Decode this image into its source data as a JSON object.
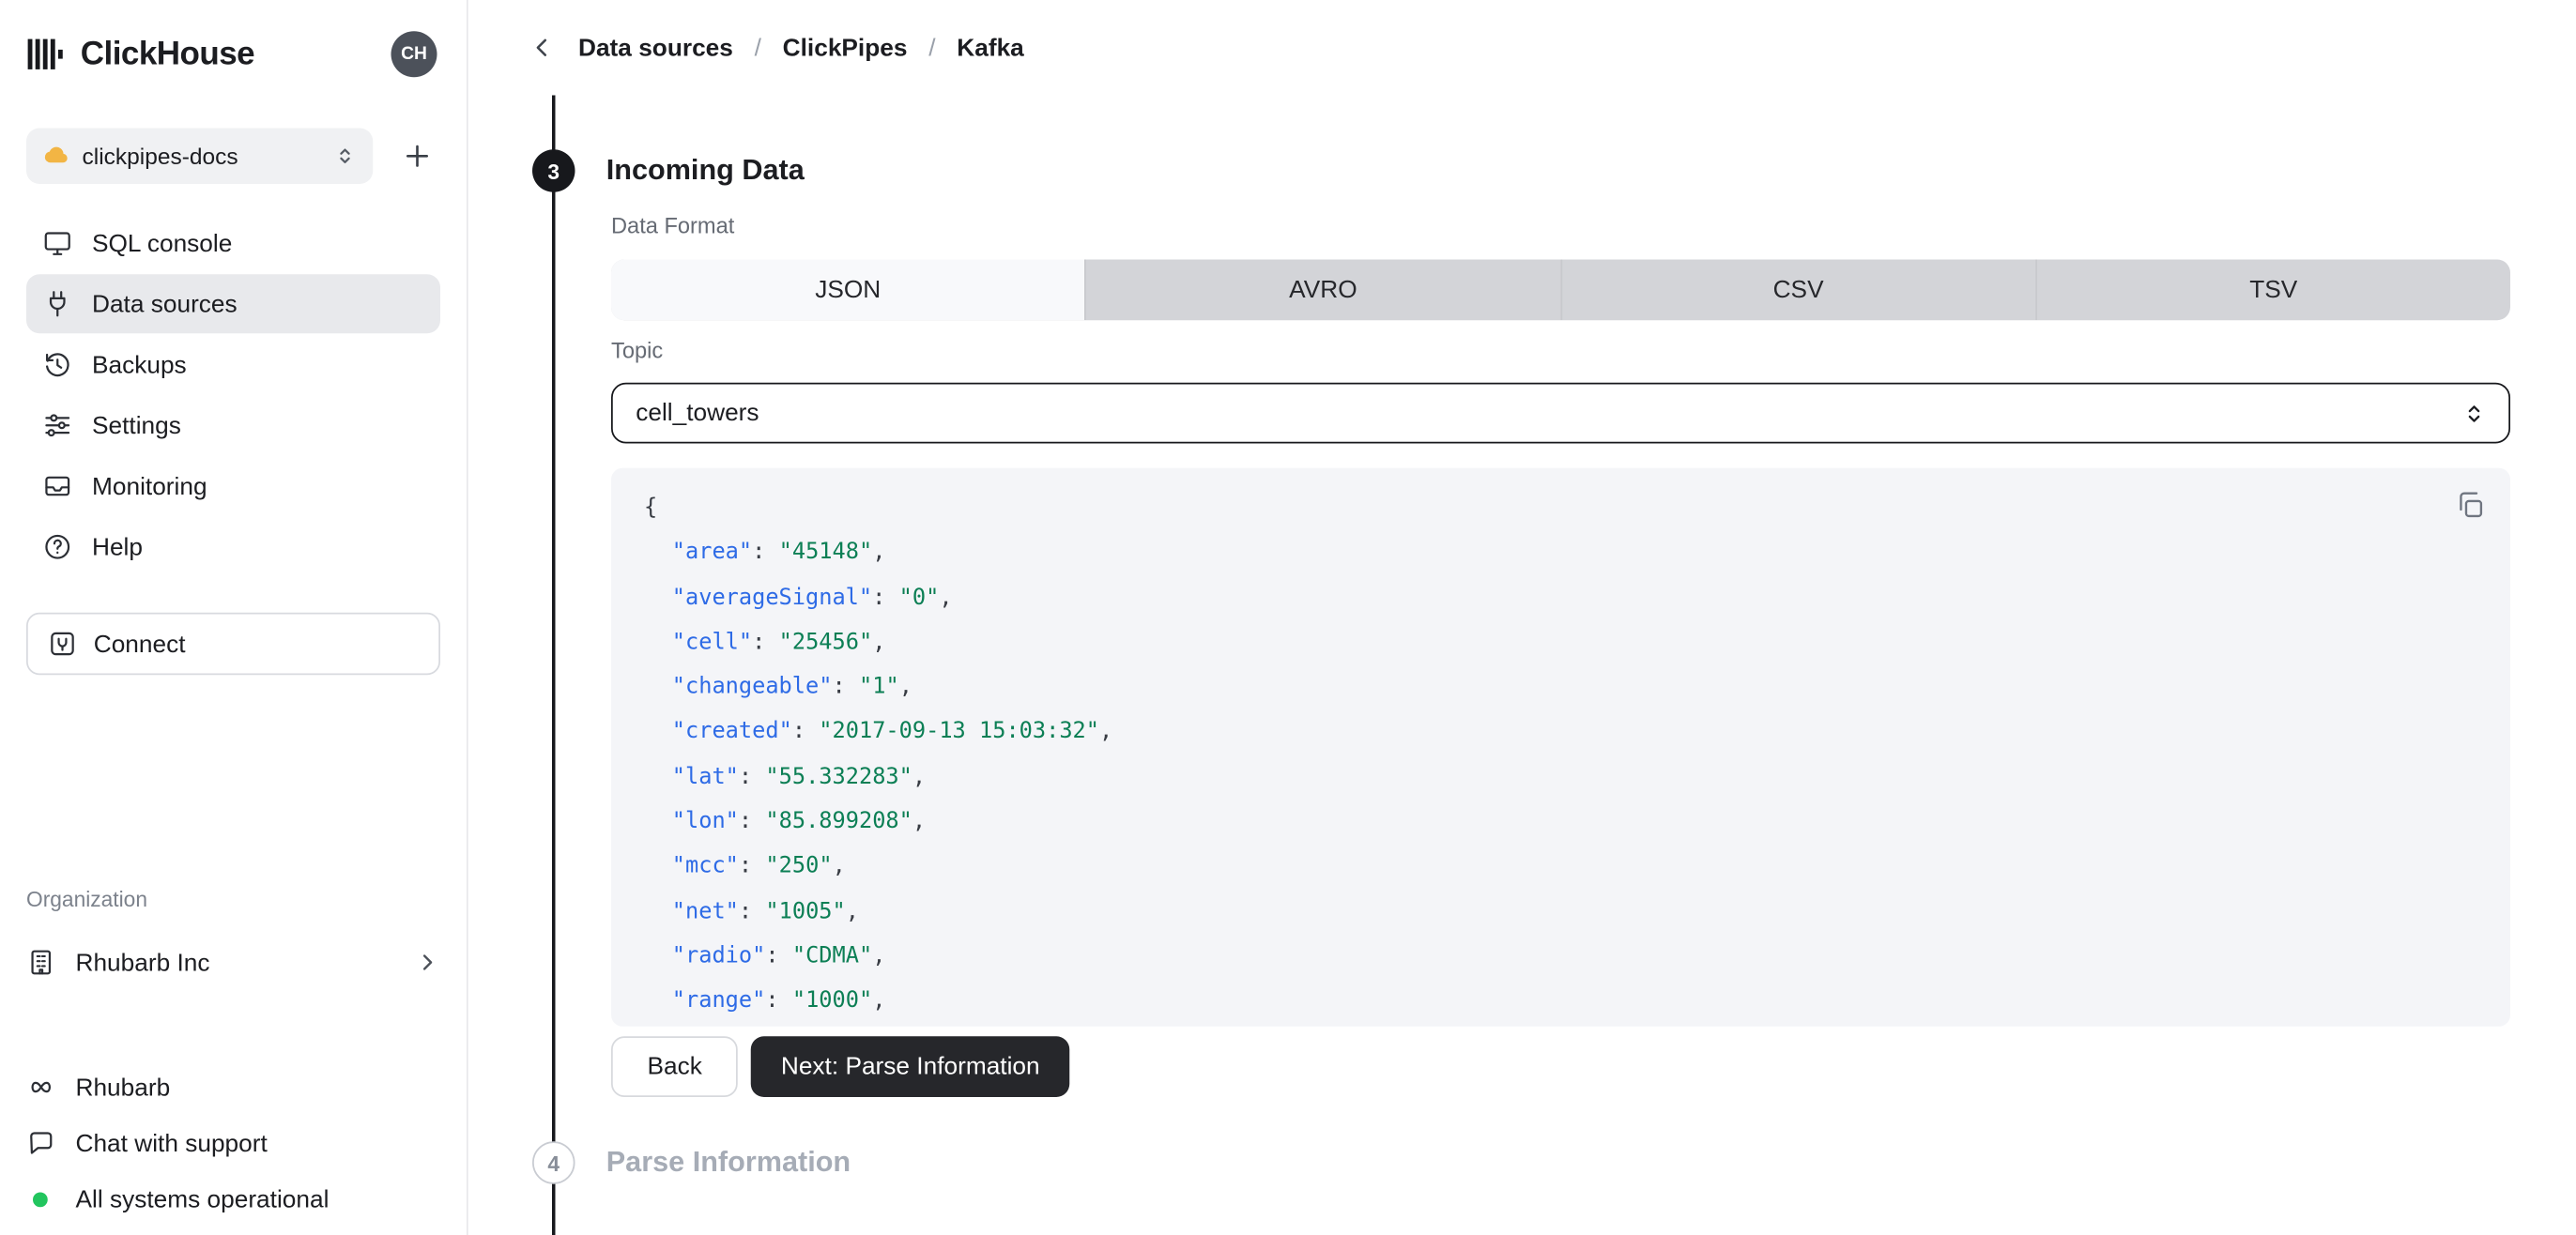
{
  "app": {
    "brand": "ClickHouse",
    "avatar_initials": "CH"
  },
  "sidebar": {
    "service": {
      "name": "clickpipes-docs"
    },
    "nav": [
      {
        "label": "SQL console"
      },
      {
        "label": "Data sources"
      },
      {
        "label": "Backups"
      },
      {
        "label": "Settings"
      },
      {
        "label": "Monitoring"
      },
      {
        "label": "Help"
      }
    ],
    "connect_label": "Connect",
    "organization_label": "Organization",
    "organization_name": "Rhubarb Inc",
    "footer": {
      "workspace": "Rhubarb",
      "support": "Chat with support",
      "status": "All systems operational"
    }
  },
  "breadcrumb": {
    "items": [
      "Data sources",
      "ClickPipes",
      "Kafka"
    ],
    "separator": "/"
  },
  "steps": {
    "current_number": "3",
    "current_title": "Incoming Data",
    "next_number": "4",
    "next_title": "Parse Information"
  },
  "form": {
    "data_format_label": "Data Format",
    "formats": [
      {
        "label": "JSON"
      },
      {
        "label": "AVRO"
      },
      {
        "label": "CSV"
      },
      {
        "label": "TSV"
      }
    ],
    "selected_format": "JSON",
    "topic_label": "Topic",
    "topic_value": "cell_towers"
  },
  "preview": {
    "open_brace": "{",
    "lines": [
      {
        "key": "area",
        "value": "45148"
      },
      {
        "key": "averageSignal",
        "value": "0"
      },
      {
        "key": "cell",
        "value": "25456"
      },
      {
        "key": "changeable",
        "value": "1"
      },
      {
        "key": "created",
        "value": "2017-09-13 15:03:32"
      },
      {
        "key": "lat",
        "value": "55.332283"
      },
      {
        "key": "lon",
        "value": "85.899208"
      },
      {
        "key": "mcc",
        "value": "250"
      },
      {
        "key": "net",
        "value": "1005"
      },
      {
        "key": "radio",
        "value": "CDMA"
      },
      {
        "key": "range",
        "value": "1000"
      }
    ]
  },
  "actions": {
    "back_label": "Back",
    "next_label": "Next: Parse Information"
  },
  "colors": {
    "accent_dark": "#17181c",
    "json_key": "#2e6be6",
    "json_value": "#0c7f55",
    "status_green": "#22c55e"
  }
}
